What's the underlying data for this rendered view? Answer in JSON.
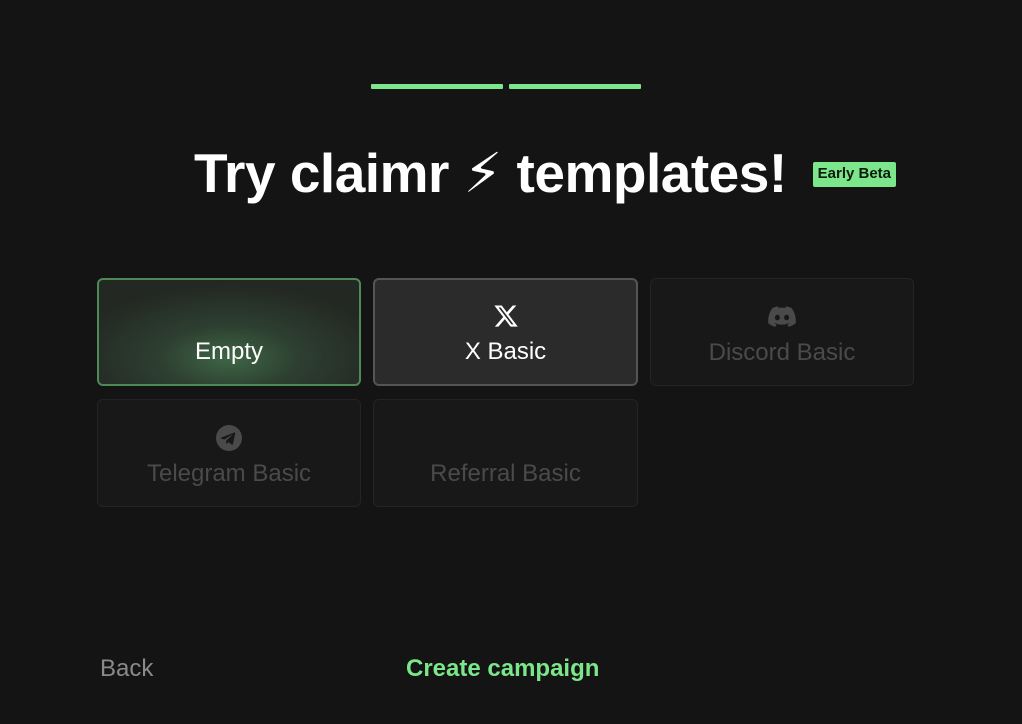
{
  "progress": {
    "steps": 2,
    "completed": 2,
    "color": "#7be68a"
  },
  "header": {
    "title": "Try claimr ⚡ templates!",
    "badge": "Early Beta",
    "badge_color": "#7be68a"
  },
  "templates": [
    {
      "label": "Empty",
      "icon": "",
      "state": "selected"
    },
    {
      "label": "X Basic",
      "icon": "x-logo-icon",
      "state": "active"
    },
    {
      "label": "Discord Basic",
      "icon": "discord-icon",
      "state": "disabled"
    },
    {
      "label": "Telegram Basic",
      "icon": "telegram-icon",
      "state": "disabled"
    },
    {
      "label": "Referral Basic",
      "icon": "",
      "state": "disabled"
    }
  ],
  "footer": {
    "back_label": "Back",
    "create_label": "Create campaign",
    "create_color": "#7be68a"
  },
  "colors": {
    "background": "#141414",
    "accent": "#7be68a"
  }
}
